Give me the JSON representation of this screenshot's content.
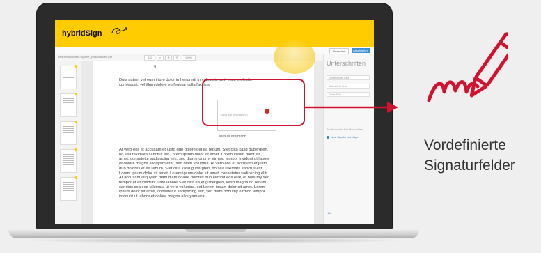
{
  "app": {
    "brand": "hybridSign",
    "cancel_label": "Abbrechen",
    "finish_label": "Abschließen",
    "filename": "beispieldokument-signiert_personalisiert.pdf",
    "toolbar_items": [
      "1/3",
      "⌕",
      "⊕",
      "⊖",
      "100%"
    ]
  },
  "document": {
    "page_number": "5",
    "paragraph_1": "Duis autem vel eum iriure dolor in hendrerit in vulputate velit esse molestie consequat, vel illum dolore eu feugiat nulla facilisis.",
    "signature_placeholder": "Max Mustermann",
    "signature_name": "Max Mustermann",
    "paragraph_2": "At vero eos et accusam et justo duo dolores et ea rebum. Stet clita kasd gubergren, no sea takimata sanctus est Lorem ipsum dolor sit amet. Lorem ipsum dolor sit amet, consetetur sadipscing elitr, sed diam nonumy eirmod tempor invidunt ut labore et dolore magna aliquyam erat, sed diam voluptua. At vero eos et accusam et justo duo dolores et ea rebum. Stet clita kasd gubergren, no sea takimata sanctus est Lorem ipsum dolor sit amet. Lorem ipsum dolor sit amet, consetetur sadipscing elitr. At accusam aliquyam diam diam dolore dolores duo eirmod eos erat, et nonumy sed tempor et et invidunt justo labore Stet clita ea et gubergren, kasd magna no rebum. sanctus sea sed takimata ut vero voluptua. est Lorem ipsum dolor sit amet. Lorem ipsum dolor sit amet, consetetur sadipscing elitr, sed diam nonumy eirmod tempor invidunt ut labore et dolore magna aliquyam erat."
  },
  "panel": {
    "title": "Unterschriften",
    "rows": [
      "Vordefiniertes Feld",
      "Unterschrift hinzu",
      "Freies Feld"
    ],
    "note": "Positionsmarke für Unterschriften",
    "link": "Neue Signatur hinzufügen",
    "bottom_link": "Hilfe"
  },
  "callout": {
    "line1": "Vordefinierte",
    "line2": "Signaturfelder"
  },
  "colors": {
    "brand_yellow": "#ffcc00",
    "accent_red": "#d2122e",
    "primary_blue": "#3b8fd4"
  }
}
